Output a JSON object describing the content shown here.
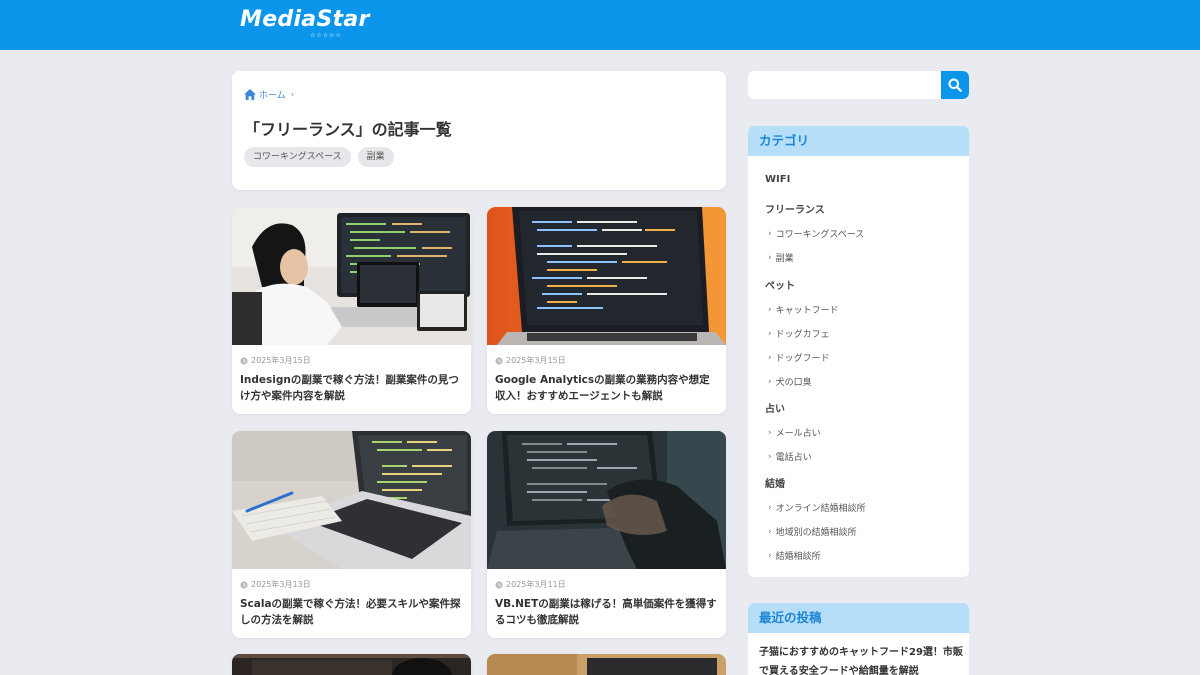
{
  "header": {
    "logo_text": "MediaStar",
    "logo_stars": "☆☆☆☆☆"
  },
  "breadcrumb": {
    "home_label": "ホーム",
    "separator": "›"
  },
  "page": {
    "title": "「フリーランス」の記事一覧"
  },
  "tags": [
    "コワーキングスペース",
    "副業"
  ],
  "articles": [
    {
      "date": "2025年3月15日",
      "title": "Indesignの副業で稼ぐ方法！副業案件の見つけ方や案件内容を解説"
    },
    {
      "date": "2025年3月15日",
      "title": "Google Analyticsの副業の業務内容や想定収入！おすすめエージェントも解説"
    },
    {
      "date": "2025年3月13日",
      "title": "Scalaの副業で稼ぐ方法！必要スキルや案件探しの方法を解説"
    },
    {
      "date": "2025年3月11日",
      "title": "VB.NETの副業は稼げる！高単価案件を獲得するコツも徹底解説"
    }
  ],
  "search": {
    "placeholder": ""
  },
  "categories_widget": {
    "title": "カテゴリ",
    "groups": [
      {
        "label": "WIFI",
        "children": []
      },
      {
        "label": "フリーランス",
        "children": [
          "コワーキングスペース",
          "副業"
        ]
      },
      {
        "label": "ペット",
        "children": [
          "キャットフード",
          "ドッグカフェ",
          "ドッグフード",
          "犬の口臭"
        ]
      },
      {
        "label": "占い",
        "children": [
          "メール占い",
          "電話占い"
        ]
      },
      {
        "label": "結婚",
        "children": [
          "オンライン結婚相談所",
          "地域別の結婚相談所",
          "結婚相談所"
        ]
      }
    ],
    "chevron": "›"
  },
  "recent_widget": {
    "title": "最近の投稿",
    "first_post": "子猫におすすめのキャットフード29選！市販で買える安全フードや給餌量を解説"
  },
  "colors": {
    "header": "#0b96ec",
    "widget_head_bg": "#b6def9",
    "widget_head_text": "#1b86d4",
    "background": "#e9ebf0"
  }
}
